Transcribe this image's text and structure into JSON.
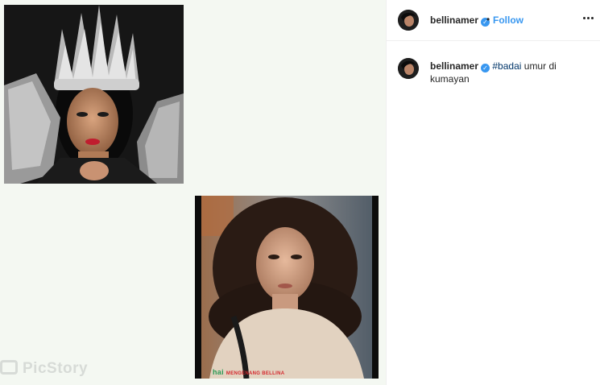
{
  "post": {
    "author": {
      "username": "bellinamer",
      "verified": true
    },
    "follow_separator": "•",
    "follow_label": "Follow",
    "more_icon": "more-options-icon",
    "caption": {
      "username": "bellinamer",
      "hashtag": "#badai",
      "text": "umur di kumayan"
    }
  },
  "media": {
    "overlay_tag": "hai",
    "overlay_sub": "MENGENANG BELLINA",
    "watermark": "PicStory"
  },
  "colors": {
    "link_blue": "#3897f0",
    "hashtag": "#003569",
    "media_bg": "#f4f8f2"
  }
}
